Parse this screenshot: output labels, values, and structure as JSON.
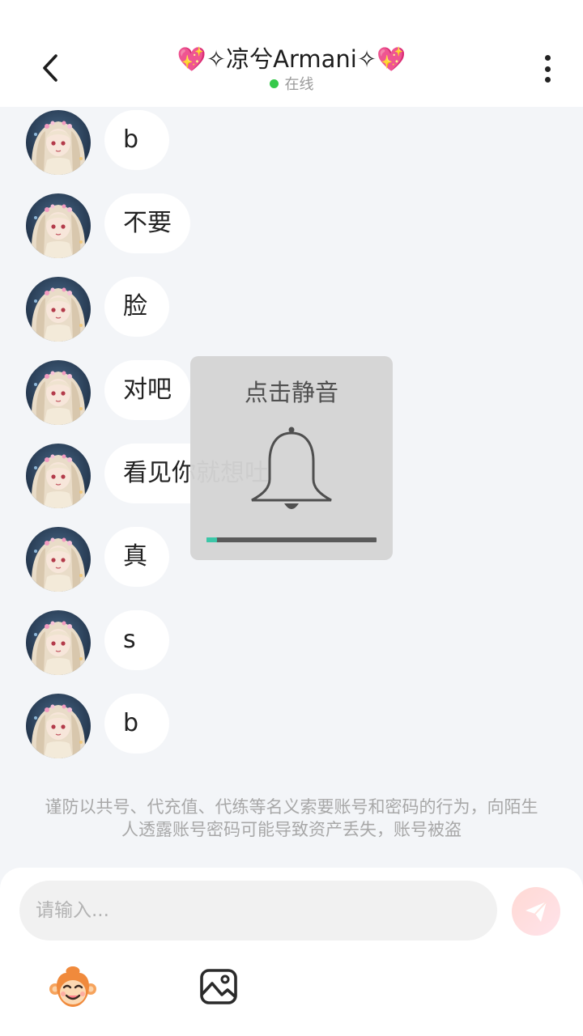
{
  "header": {
    "title": "💖✧凉兮Armani✧💖",
    "status": "在线",
    "status_color": "#35c94a"
  },
  "messages": [
    {
      "text": "b"
    },
    {
      "text": "不要"
    },
    {
      "text": "脸"
    },
    {
      "text": "对吧"
    },
    {
      "text": "看见你就想吐"
    },
    {
      "text": "真"
    },
    {
      "text": "s"
    },
    {
      "text": "b"
    }
  ],
  "notice": "谨防以共号、代充值、代练等名义索要账号和密码的行为，向陌生人透露账号密码可能导致资产丢失，账号被盗",
  "composer": {
    "placeholder": "请输入..."
  },
  "mute_overlay": {
    "title": "点击静音",
    "progress": 0.06,
    "accent_color": "#3cc7a8"
  },
  "icons": {
    "back": "chevron-left-icon",
    "more": "more-vertical-icon",
    "send": "paper-plane-icon",
    "emoji": "monkey-face-icon",
    "image": "image-icon",
    "bell": "bell-icon"
  }
}
